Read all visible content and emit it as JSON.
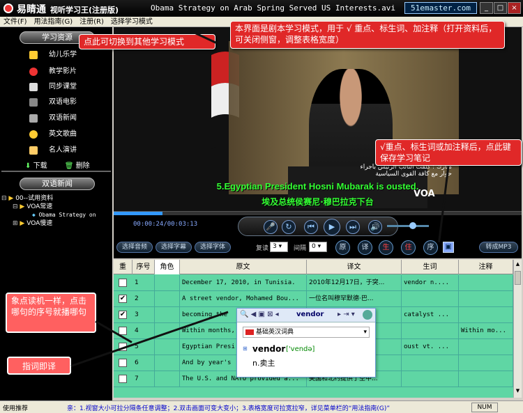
{
  "window": {
    "app_name": "易睛通",
    "app_subtitle": "视听学习王(注册版)",
    "file_title": "Obama Strategy on Arab Spring Served US Interests.avi",
    "brand": "51emaster.com"
  },
  "menu": [
    "文件(F)",
    "用法指南(G)",
    "注册(R)",
    "选择学习模式"
  ],
  "sidebar": {
    "section1_title": "学习资源",
    "items": [
      "幼儿乐学",
      "教学影片",
      "同步课堂",
      "双语电影",
      "双语新闻",
      "英文歌曲",
      "名人演讲"
    ],
    "download_label": "下载",
    "delete_label": "删除",
    "section2_title": "双语新闻",
    "tree": [
      "00--试用资料",
      "VOA常速",
      "Obama Strategy on",
      "VOA慢速"
    ]
  },
  "video": {
    "subtitle_en": "5.Egyptian President Hosni Mubarak is ousted.",
    "subtitle_cn": "埃及总统侯赛尼·穆巴拉克下台",
    "arabic_text": "مبارك : كلفت النائب الرئيس باجراء حوار مع كافة القوى السياسية",
    "logo": "VOA",
    "time": "00:00:24/00:03:13",
    "progress": 0.12
  },
  "toolbar": {
    "select_audio": "选择音频",
    "select_subtitle": "选择字幕",
    "select_font": "选择字体",
    "repeat_label": "复读",
    "repeat_value": "3",
    "interval_label": "间隔",
    "interval_value": "0",
    "mode_buttons": [
      "原",
      "译",
      "生",
      "住",
      "序"
    ],
    "to_mp3": "转成MP3"
  },
  "grid": {
    "headers": [
      "重",
      "序号",
      "角色",
      "原文",
      "译文",
      "生词",
      "注释"
    ],
    "rows": [
      {
        "checked": false,
        "num": "1",
        "role": "",
        "orig": "December 17, 2010, in Tunisia.",
        "trans": "2010年12月17日，于突...",
        "vocab": "vendor n....",
        "note": ""
      },
      {
        "checked": true,
        "num": "2",
        "role": "",
        "orig": "A street vendor, Mohamed Bou...",
        "trans": "一位名叫穆罕默德·巴...",
        "vocab": "",
        "note": ""
      },
      {
        "checked": true,
        "num": "3",
        "role": "",
        "orig": "becoming the",
        "trans": "",
        "vocab": "catalyst ...",
        "note": ""
      },
      {
        "checked": false,
        "num": "4",
        "role": "",
        "orig": "Within months,",
        "trans": "",
        "vocab": "",
        "note": "Within mo..."
      },
      {
        "checked": false,
        "num": "5",
        "role": "",
        "orig": "Egyptian Presi",
        "trans": "总统",
        "vocab": "oust vt. ...",
        "note": ""
      },
      {
        "checked": false,
        "num": "6",
        "role": "",
        "orig": "And by year's",
        "trans": "",
        "vocab": "",
        "note": ""
      },
      {
        "checked": false,
        "num": "7",
        "role": "",
        "orig": "The U.S. and NATO provided a...",
        "trans": "美国和北约提供了空中...",
        "vocab": "",
        "note": ""
      }
    ]
  },
  "popup": {
    "search": "vendor",
    "dictionary": "基础英汉词典",
    "word": "vendor",
    "ipa": "['vendə]",
    "definition": "n.卖主"
  },
  "status": {
    "left": "使用推荐",
    "tip": "亲：1.视窗大小可拉分隔条任意调整；2.双击画面可变大变小；3.表格宽度可拉宽拉窄，详见菜单栏的“用法指南(G)”",
    "num": "NUM"
  },
  "annotations": {
    "top_right": "本界面是剧本学习模式，用于 √ 重点、标生词、加注释（打开资料后，可关闭侧窗，调整表格宽度）",
    "left_mode": "点此可切换到其他学习模式",
    "save": "√重点、标生词或加注释后，点此键保存学习笔记",
    "click_read": "象点读机一样，点击哪句的序号就播哪句",
    "point_translate": "指词即译"
  }
}
